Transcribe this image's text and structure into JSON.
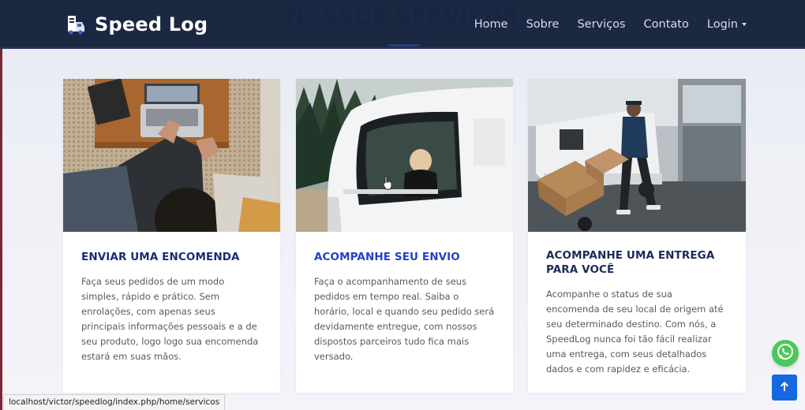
{
  "navbar": {
    "brand": "Speed Log",
    "section_title": "NOSSOS SERVIÇOS",
    "links": [
      {
        "label": "Home"
      },
      {
        "label": "Sobre"
      },
      {
        "label": "Serviços"
      },
      {
        "label": "Contato"
      },
      {
        "label": "Login"
      }
    ]
  },
  "cards": [
    {
      "title": "ENVIAR UMA ENCOMENDA",
      "text": "Faça seus pedidos de um modo simples, rápido e prático. Sem enrolações, com apenas seus principais informações pessoais e a de seu produto, logo logo sua encomenda estará em suas mãos."
    },
    {
      "title": "ACOMPANHE SEU ENVIO",
      "text": "Faça o acompanhamento de seus pedidos em tempo real. Saiba o horário, local e quando seu pedido será devidamente entregue, com nossos dispostos parceiros tudo fica mais versado."
    },
    {
      "title": "ACOMPANHE UMA ENTREGA PARA VOCÊ",
      "text": "Acompanhe o status de sua encomenda de seu local de origem até seu determinado destino. Com nós, a SpeedLog nunca foi tão fácil realizar uma entrega, com seus detalhados dados e com rapidez e eficácia."
    }
  ],
  "status_bar": {
    "url": "localhost/victor/speedlog/index.php/home/servicos"
  },
  "icons": {
    "brand": "delivery-logo-icon",
    "whatsapp": "whatsapp-icon",
    "scroll_top": "arrow-up-icon",
    "dropdown": "caret-down-icon"
  },
  "colors": {
    "navbar": "#1b2841",
    "title_blue": "#2541c9",
    "title_navy": "#1b2a7a",
    "whatsapp": "#4cc85a",
    "scroll_top": "#1568e0"
  }
}
